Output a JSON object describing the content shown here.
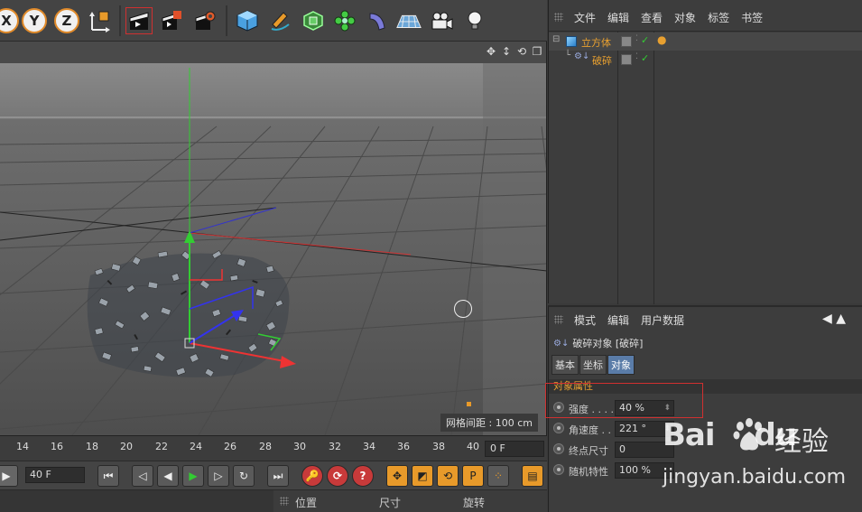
{
  "toolbar": {
    "axis_x": "X",
    "axis_y": "Y",
    "axis_z": "Z"
  },
  "viewport": {
    "grid_spacing": "网格间距 : 100 cm"
  },
  "timeline": {
    "ticks": [
      "14",
      "16",
      "18",
      "20",
      "22",
      "24",
      "26",
      "28",
      "30",
      "32",
      "34",
      "36",
      "38",
      "40"
    ],
    "current_frame": "0 F"
  },
  "playback": {
    "end_frame": "40 F"
  },
  "coordinates": {
    "position": "位置",
    "size": "尺寸",
    "rotation": "旋转"
  },
  "object_manager": {
    "menu": [
      "文件",
      "编辑",
      "查看",
      "对象",
      "标签",
      "书签"
    ],
    "objects": [
      {
        "name": "立方体"
      },
      {
        "name": "破碎"
      }
    ]
  },
  "attribute_manager": {
    "menu": [
      "模式",
      "编辑",
      "用户数据"
    ],
    "title": "破碎对象 [破碎]",
    "tabs": [
      "基本",
      "坐标",
      "对象"
    ],
    "section": "对象属性",
    "params": [
      {
        "label": "强度 . . . .",
        "value": "40 %"
      },
      {
        "label": "角速度 . .",
        "value": "221 °"
      },
      {
        "label": "终点尺寸",
        "value": "0"
      },
      {
        "label": "随机特性",
        "value": "100 %"
      }
    ]
  },
  "watermark": {
    "logo": "Bai",
    "logo_tail": "du",
    "cn": "经验",
    "url": "jingyan.baidu.com"
  }
}
